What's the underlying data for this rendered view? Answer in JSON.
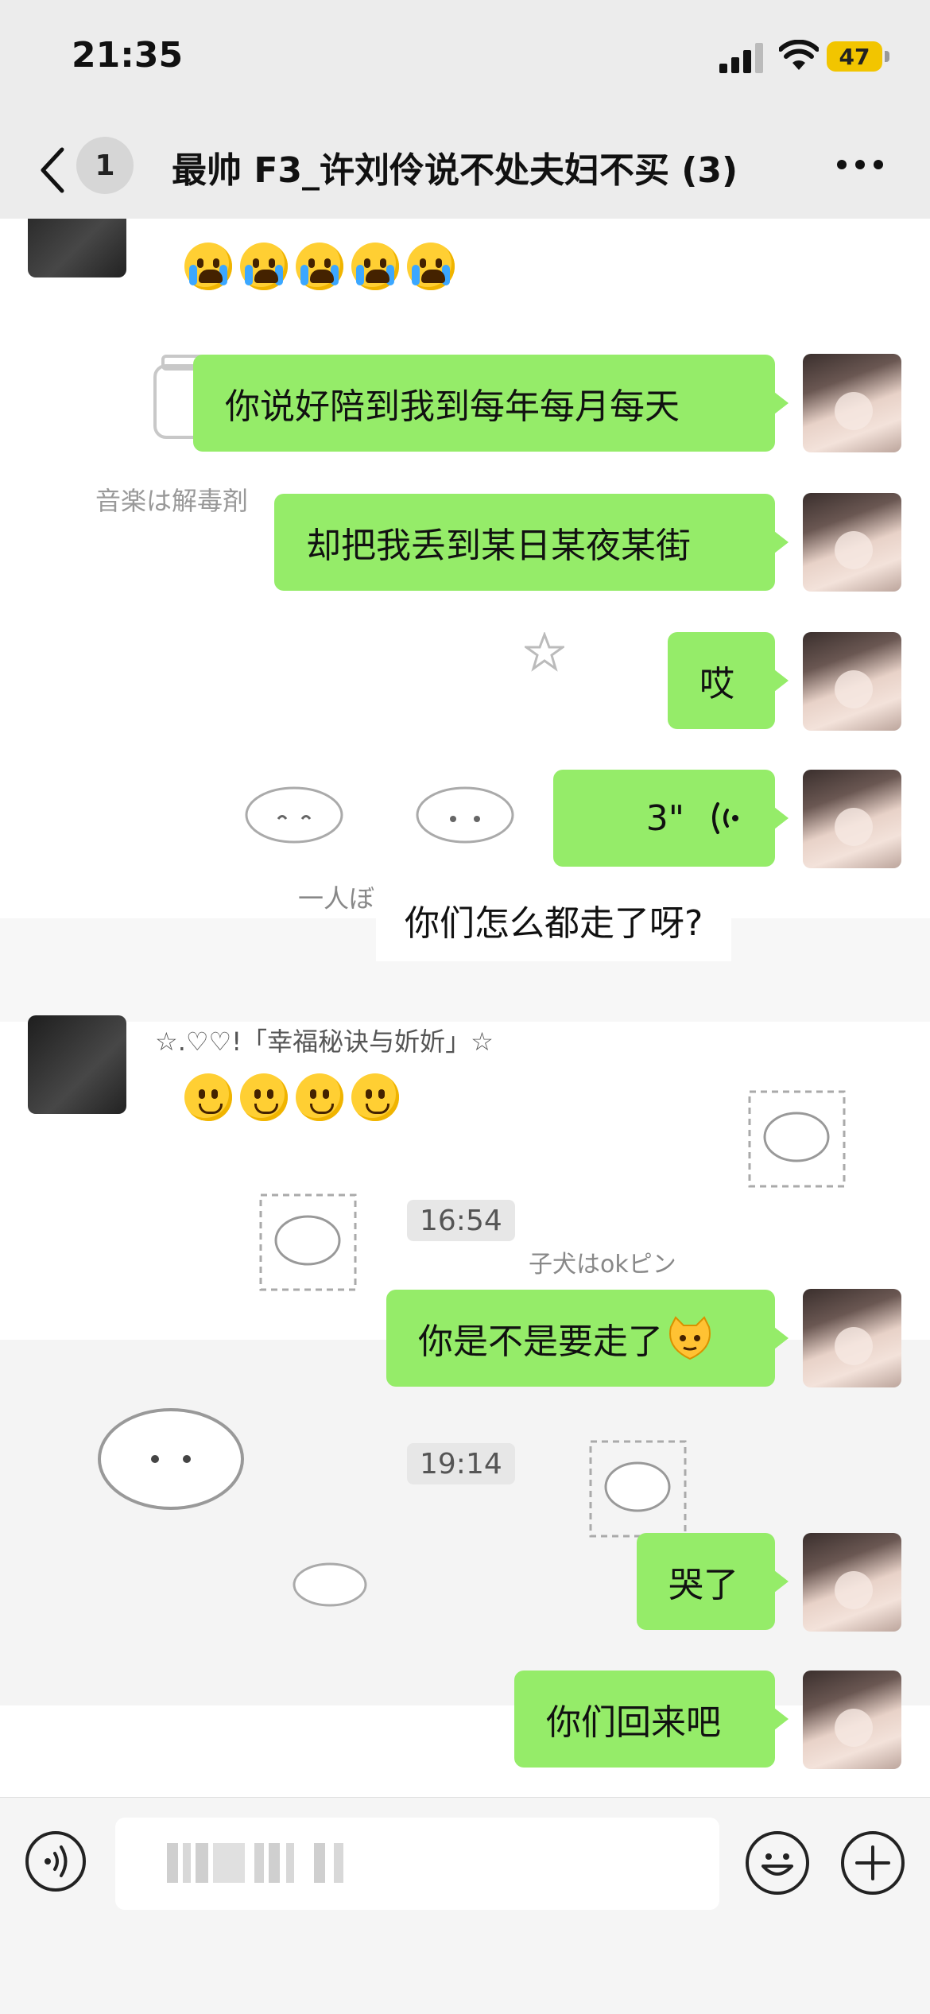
{
  "status_bar": {
    "time": "21:35",
    "battery": "47"
  },
  "header": {
    "back_count": "1",
    "title": "最帅 F3_许刘伶说不处夫妇不买 (3)"
  },
  "messages": [
    {
      "id": "m1",
      "side": "left",
      "type": "emoji",
      "count": 5,
      "emoji": "loudly-crying-face"
    },
    {
      "id": "m2",
      "side": "right",
      "text": "你说好陪到我到每年每月每天"
    },
    {
      "id": "m3",
      "side": "right",
      "text": "却把我丢到某日某夜某街"
    },
    {
      "id": "m4",
      "side": "right",
      "text": "哎"
    },
    {
      "id": "m5",
      "side": "right",
      "type": "voice",
      "duration": "3\""
    },
    {
      "id": "m6",
      "side": "center",
      "text": "你们怎么都走了呀?"
    },
    {
      "id": "m7",
      "side": "left",
      "sender": "☆.♡♡!「幸福秘诀与妡妡」☆",
      "type": "emoji",
      "count": 4,
      "emoji": "slightly-smiling-face"
    },
    {
      "id": "t1",
      "type": "timestamp",
      "text": "16:54"
    },
    {
      "id": "m8",
      "side": "right",
      "text": "你是不是要走了"
    },
    {
      "id": "t2",
      "type": "timestamp",
      "text": "19:14"
    },
    {
      "id": "m9",
      "side": "right",
      "text": "哭了"
    },
    {
      "id": "m10",
      "side": "right",
      "text": "你们回来吧"
    }
  ],
  "background_text": {
    "line1": "音楽は解毒剤",
    "line2": "一人ぼ",
    "line3": "子犬はokピン"
  },
  "input_bar": {
    "placeholder": ""
  },
  "colors": {
    "bubble": "#95ec69",
    "header_bg": "#ececec",
    "battery": "#f2c500"
  }
}
